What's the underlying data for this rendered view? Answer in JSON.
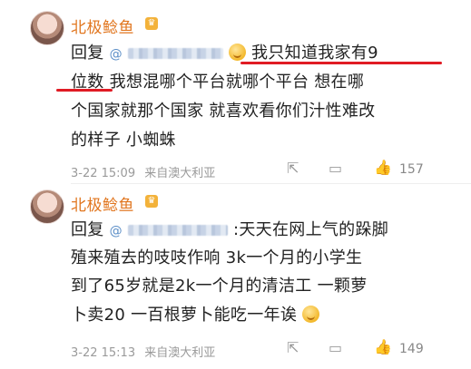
{
  "comments": [
    {
      "username": "北极鲶鱼",
      "reply_prefix": "回复",
      "lines": [
        "我只知道我家有9",
        "位数",
        "我想混哪个平台就哪个平台 想在哪",
        "个国家就那个国家 就喜欢看你们汁性难改",
        "的样子 小蜘蛛"
      ],
      "timestamp": "3-22 15:09",
      "source": "来自澳大利亚",
      "likes": "157"
    },
    {
      "username": "北极鲶鱼",
      "reply_prefix": "回复",
      "lines": [
        ":天天在网上气的跺脚",
        "殖来殖去的吱吱作响 3k一个月的小学生",
        "到了65岁就是2k一个月的清洁工 一颗萝",
        "卜卖20 一百根萝卜能吃一年诶"
      ],
      "timestamp": "3-22 15:13",
      "source": "来自澳大利亚",
      "likes": "149"
    }
  ],
  "icons": {
    "vip": "crown-badge-icon",
    "share": "share-icon",
    "comment": "comment-icon",
    "like": "thumbs-up-icon",
    "mention": "at-icon"
  },
  "colors": {
    "username": "#e1761f",
    "annotation": "#e01b24",
    "meta": "#9a9a9a"
  }
}
